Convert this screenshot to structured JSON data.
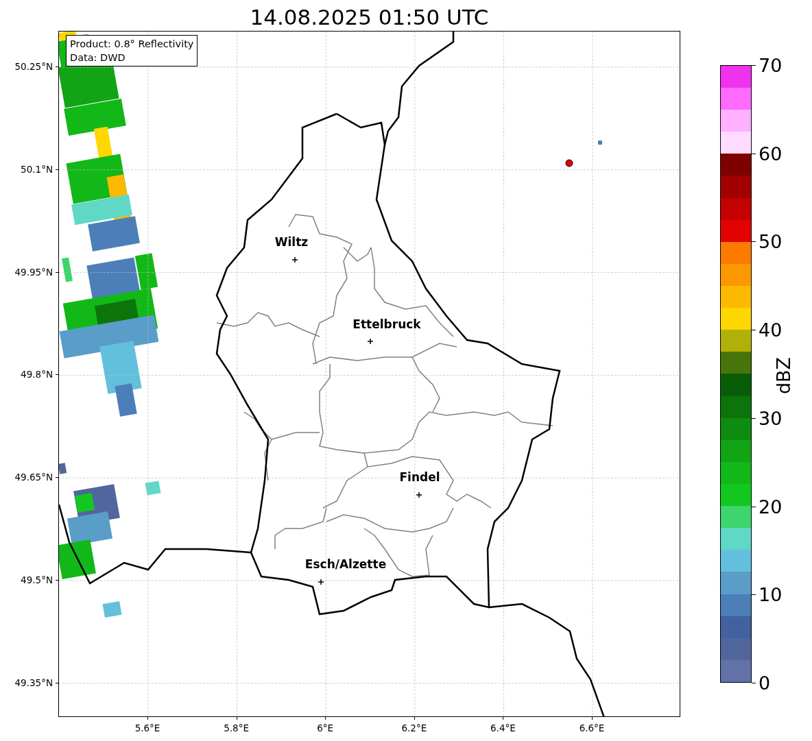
{
  "title": "14.08.2025 01:50 UTC",
  "info_box": [
    "Product: 0.8° Reflectivity",
    "Data: DWD"
  ],
  "cities": [
    "Wiltz",
    "Ettelbruck",
    "Findel",
    "Esch/Alzette"
  ],
  "x_ticks": [
    "5.6°E",
    "5.8°E",
    "6°E",
    "6.2°E",
    "6.4°E",
    "6.6°E"
  ],
  "y_ticks": [
    "50.25°N",
    "50.1°N",
    "49.95°N",
    "49.8°N",
    "49.65°N",
    "49.5°N",
    "49.35°N"
  ],
  "colorbar": {
    "label": "dBZ",
    "ticks": [
      "70",
      "60",
      "50",
      "40",
      "30",
      "20",
      "10",
      "0"
    ],
    "bands": [
      {
        "color": "#6272a8"
      },
      {
        "color": "#52669e"
      },
      {
        "color": "#4360a0"
      },
      {
        "color": "#4c7fb8"
      },
      {
        "color": "#5a9dc8"
      },
      {
        "color": "#62c0dc"
      },
      {
        "color": "#5fd8c6"
      },
      {
        "color": "#3dd56e"
      },
      {
        "color": "#12c81f"
      },
      {
        "color": "#12b818"
      },
      {
        "color": "#11a415"
      },
      {
        "color": "#0e8c11"
      },
      {
        "color": "#0b750c"
      },
      {
        "color": "#085e08"
      },
      {
        "color": "#477509"
      },
      {
        "color": "#b0b008"
      },
      {
        "color": "#fed600"
      },
      {
        "color": "#fdb900"
      },
      {
        "color": "#fc9700"
      },
      {
        "color": "#fc7a00"
      },
      {
        "color": "#e30000"
      },
      {
        "color": "#c40000"
      },
      {
        "color": "#a20000"
      },
      {
        "color": "#7f0000"
      },
      {
        "color": "#ffdcff"
      },
      {
        "color": "#ffb0ff"
      },
      {
        "color": "#ff6aff"
      },
      {
        "color": "#ee32ee"
      }
    ]
  }
}
